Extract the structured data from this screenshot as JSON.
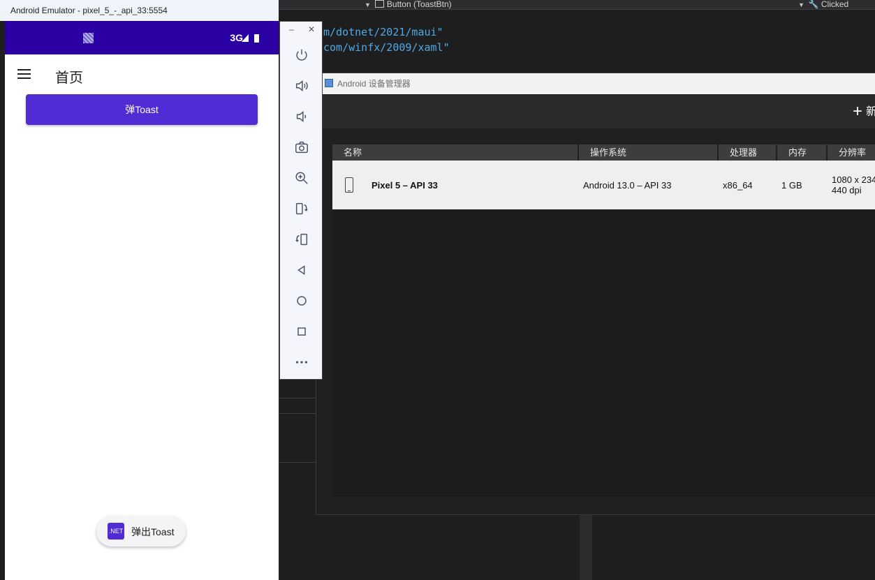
{
  "vs": {
    "dropdown_left_label": "Button (ToastBtn)",
    "dropdown_right_label": "Clicked",
    "code_line_1": "m/dotnet/2021/maui\"",
    "code_line_2": "com/winfx/2009/xaml\""
  },
  "device_manager": {
    "title": "Android 设备管理器",
    "new_button": "新",
    "columns": [
      "名称",
      "操作系统",
      "处理器",
      "内存",
      "分辨率"
    ],
    "devices": [
      {
        "name": "Pixel 5 – API 33",
        "os": "Android 13.0 – API 33",
        "cpu": "x86_64",
        "memory": "1 GB",
        "resolution": "1080 x 234",
        "dpi": "440 dpi"
      }
    ]
  },
  "emulator": {
    "title": "Android Emulator - pixel_5_-_api_33:5554",
    "status_network": "3G",
    "page_title": "首页",
    "toast_button_label": "弹Toast",
    "toast_icon_text": ".NET",
    "toast_message": "弹出Toast",
    "side_icons": [
      "power-icon",
      "volume-up-icon",
      "volume-down-icon",
      "camera-icon",
      "zoom-icon",
      "rotate-left-icon",
      "rotate-right-icon",
      "back-icon",
      "home-icon",
      "overview-icon",
      "more-icon"
    ]
  },
  "colors": {
    "accent": "#512bd4",
    "status_bar": "#2a00a4"
  }
}
